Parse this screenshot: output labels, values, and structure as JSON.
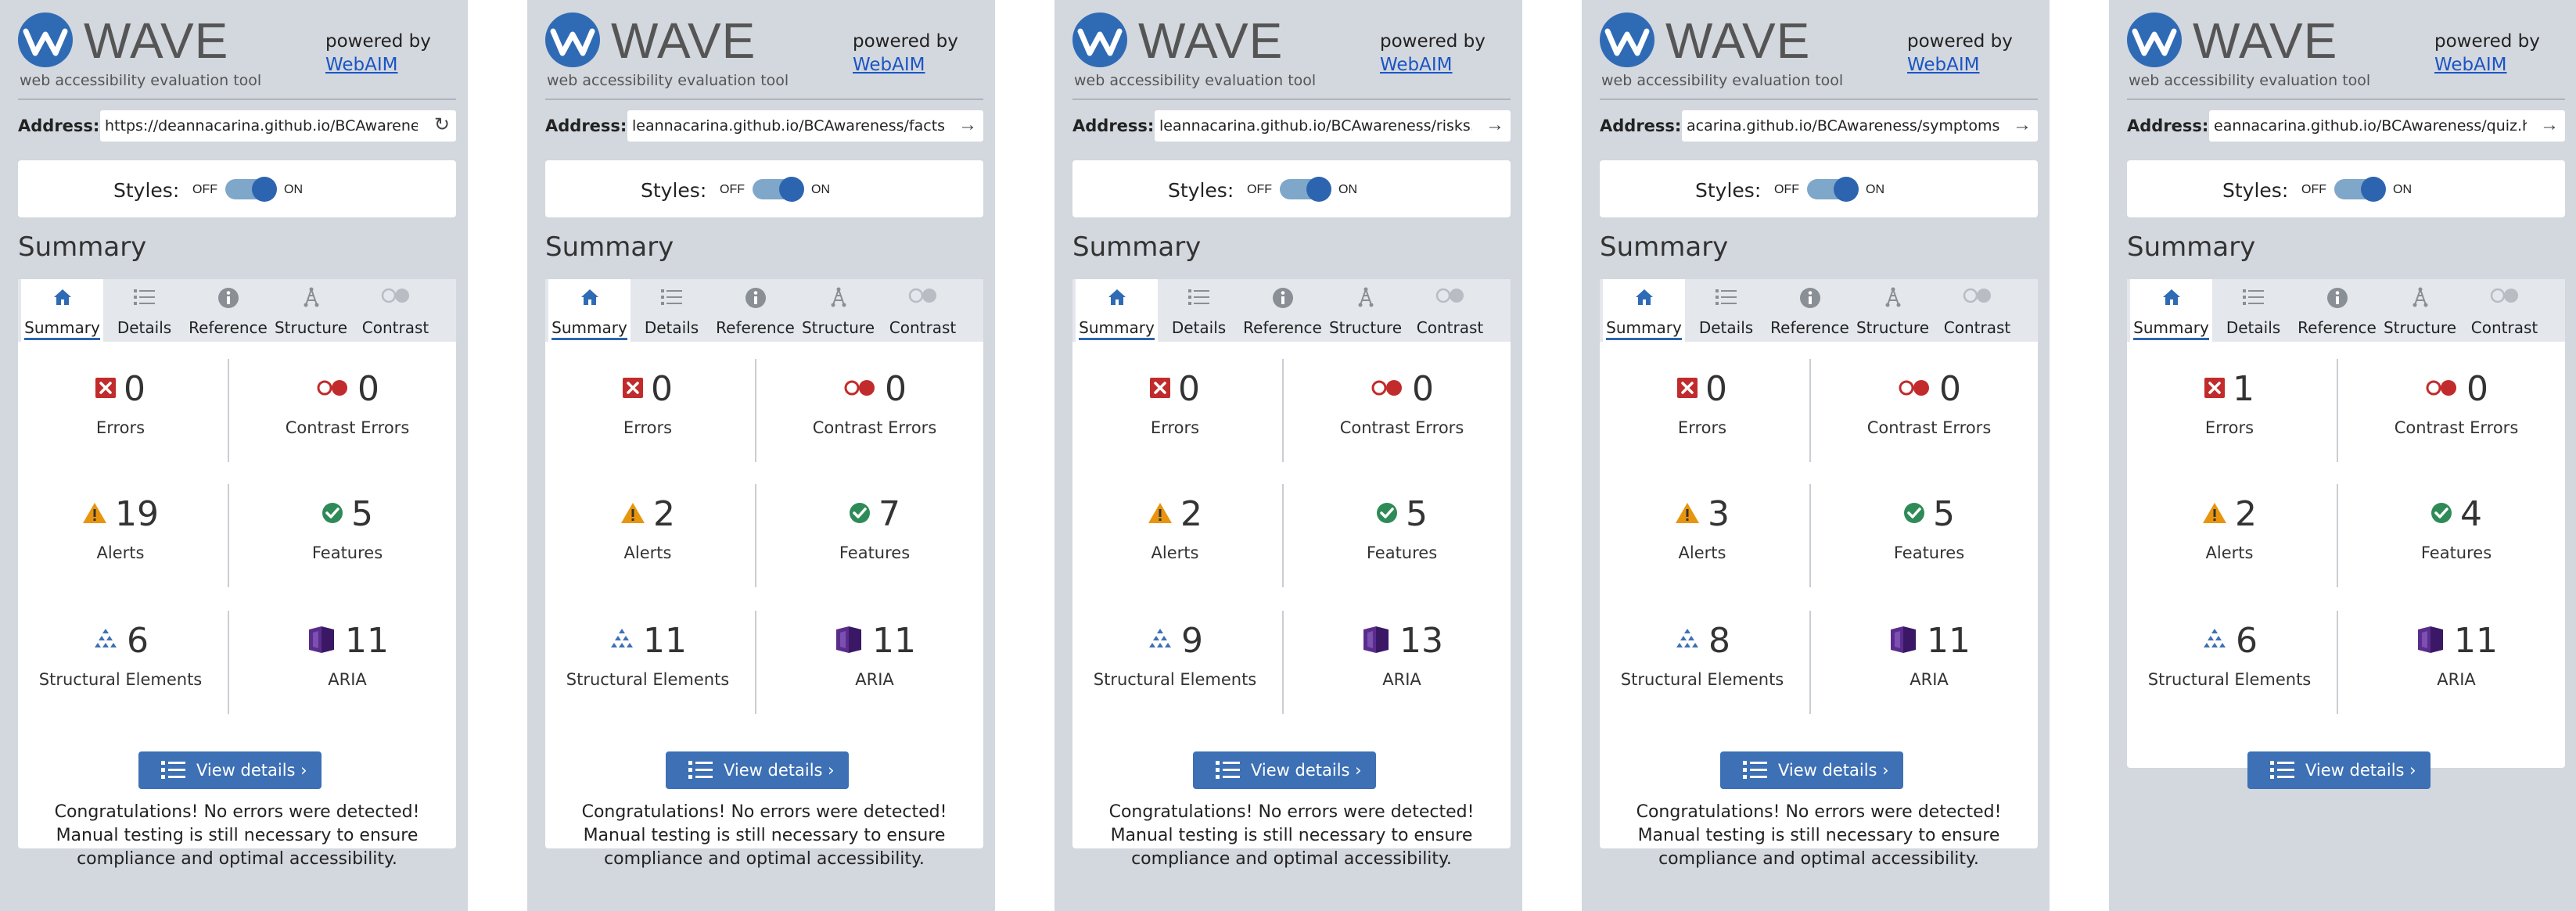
{
  "panels": [
    {
      "logo_text": "WAVE",
      "tagline": "web accessibility evaluation tool",
      "powered_by": "powered by",
      "webaim_link": "WebAIM",
      "address_label": "Address:",
      "address_value": "https://deannacarina.github.io/BCAwarene",
      "address_action_icon": "reload-icon",
      "styles_label": "Styles:",
      "styles_off": "OFF",
      "styles_on": "ON",
      "summary_heading": "Summary",
      "tabs": [
        "Summary",
        "Details",
        "Reference",
        "Structure",
        "Contrast"
      ],
      "stats": {
        "errors": {
          "value": "0",
          "label": "Errors"
        },
        "contrast": {
          "value": "0",
          "label": "Contrast Errors"
        },
        "alerts": {
          "value": "19",
          "label": "Alerts"
        },
        "features": {
          "value": "5",
          "label": "Features"
        },
        "structure": {
          "value": "6",
          "label": "Structural Elements"
        },
        "aria": {
          "value": "11",
          "label": "ARIA"
        }
      },
      "view_details": "View details ›",
      "message": "Congratulations! No errors were detected! Manual testing is still necessary to ensure compliance and optimal accessibility."
    },
    {
      "logo_text": "WAVE",
      "tagline": "web accessibility evaluation tool",
      "powered_by": "powered by",
      "webaim_link": "WebAIM",
      "address_label": "Address:",
      "address_value": "leannacarina.github.io/BCAwareness/facts.l",
      "address_action_icon": "arrow-right-icon",
      "styles_label": "Styles:",
      "styles_off": "OFF",
      "styles_on": "ON",
      "summary_heading": "Summary",
      "tabs": [
        "Summary",
        "Details",
        "Reference",
        "Structure",
        "Contrast"
      ],
      "stats": {
        "errors": {
          "value": "0",
          "label": "Errors"
        },
        "contrast": {
          "value": "0",
          "label": "Contrast Errors"
        },
        "alerts": {
          "value": "2",
          "label": "Alerts"
        },
        "features": {
          "value": "7",
          "label": "Features"
        },
        "structure": {
          "value": "11",
          "label": "Structural Elements"
        },
        "aria": {
          "value": "11",
          "label": "ARIA"
        }
      },
      "view_details": "View details ›",
      "message": "Congratulations! No errors were detected! Manual testing is still necessary to ensure compliance and optimal accessibility."
    },
    {
      "logo_text": "WAVE",
      "tagline": "web accessibility evaluation tool",
      "powered_by": "powered by",
      "webaim_link": "WebAIM",
      "address_label": "Address:",
      "address_value": "leannacarina.github.io/BCAwareness/risks.l",
      "address_action_icon": "arrow-right-icon",
      "styles_label": "Styles:",
      "styles_off": "OFF",
      "styles_on": "ON",
      "summary_heading": "Summary",
      "tabs": [
        "Summary",
        "Details",
        "Reference",
        "Structure",
        "Contrast"
      ],
      "stats": {
        "errors": {
          "value": "0",
          "label": "Errors"
        },
        "contrast": {
          "value": "0",
          "label": "Contrast Errors"
        },
        "alerts": {
          "value": "2",
          "label": "Alerts"
        },
        "features": {
          "value": "5",
          "label": "Features"
        },
        "structure": {
          "value": "9",
          "label": "Structural Elements"
        },
        "aria": {
          "value": "13",
          "label": "ARIA"
        }
      },
      "view_details": "View details ›",
      "message": "Congratulations! No errors were detected! Manual testing is still necessary to ensure compliance and optimal accessibility."
    },
    {
      "logo_text": "WAVE",
      "tagline": "web accessibility evaluation tool",
      "powered_by": "powered by",
      "webaim_link": "WebAIM",
      "address_label": "Address:",
      "address_value": "acarina.github.io/BCAwareness/symptoms",
      "address_action_icon": "arrow-right-icon",
      "styles_label": "Styles:",
      "styles_off": "OFF",
      "styles_on": "ON",
      "summary_heading": "Summary",
      "tabs": [
        "Summary",
        "Details",
        "Reference",
        "Structure",
        "Contrast"
      ],
      "stats": {
        "errors": {
          "value": "0",
          "label": "Errors"
        },
        "contrast": {
          "value": "0",
          "label": "Contrast Errors"
        },
        "alerts": {
          "value": "3",
          "label": "Alerts"
        },
        "features": {
          "value": "5",
          "label": "Features"
        },
        "structure": {
          "value": "8",
          "label": "Structural Elements"
        },
        "aria": {
          "value": "11",
          "label": "ARIA"
        }
      },
      "view_details": "View details ›",
      "message": "Congratulations! No errors were detected! Manual testing is still necessary to ensure compliance and optimal accessibility."
    },
    {
      "logo_text": "WAVE",
      "tagline": "web accessibility evaluation tool",
      "powered_by": "powered by",
      "webaim_link": "WebAIM",
      "address_label": "Address:",
      "address_value": "eannacarina.github.io/BCAwareness/quiz.ht",
      "address_action_icon": "arrow-right-icon",
      "styles_label": "Styles:",
      "styles_off": "OFF",
      "styles_on": "ON",
      "summary_heading": "Summary",
      "tabs": [
        "Summary",
        "Details",
        "Reference",
        "Structure",
        "Contrast"
      ],
      "stats": {
        "errors": {
          "value": "1",
          "label": "Errors"
        },
        "contrast": {
          "value": "0",
          "label": "Contrast Errors"
        },
        "alerts": {
          "value": "2",
          "label": "Alerts"
        },
        "features": {
          "value": "4",
          "label": "Features"
        },
        "structure": {
          "value": "6",
          "label": "Structural Elements"
        },
        "aria": {
          "value": "11",
          "label": "ARIA"
        }
      },
      "view_details": "View details ›",
      "message": ""
    }
  ],
  "colors": {
    "panel_bg": "#d3d7de",
    "brand_blue": "#2f6bb5",
    "error_red": "#c22b2b",
    "alert_orange": "#e8950d",
    "feature_green": "#2e8b57",
    "aria_purple": "#5a2d8c"
  }
}
